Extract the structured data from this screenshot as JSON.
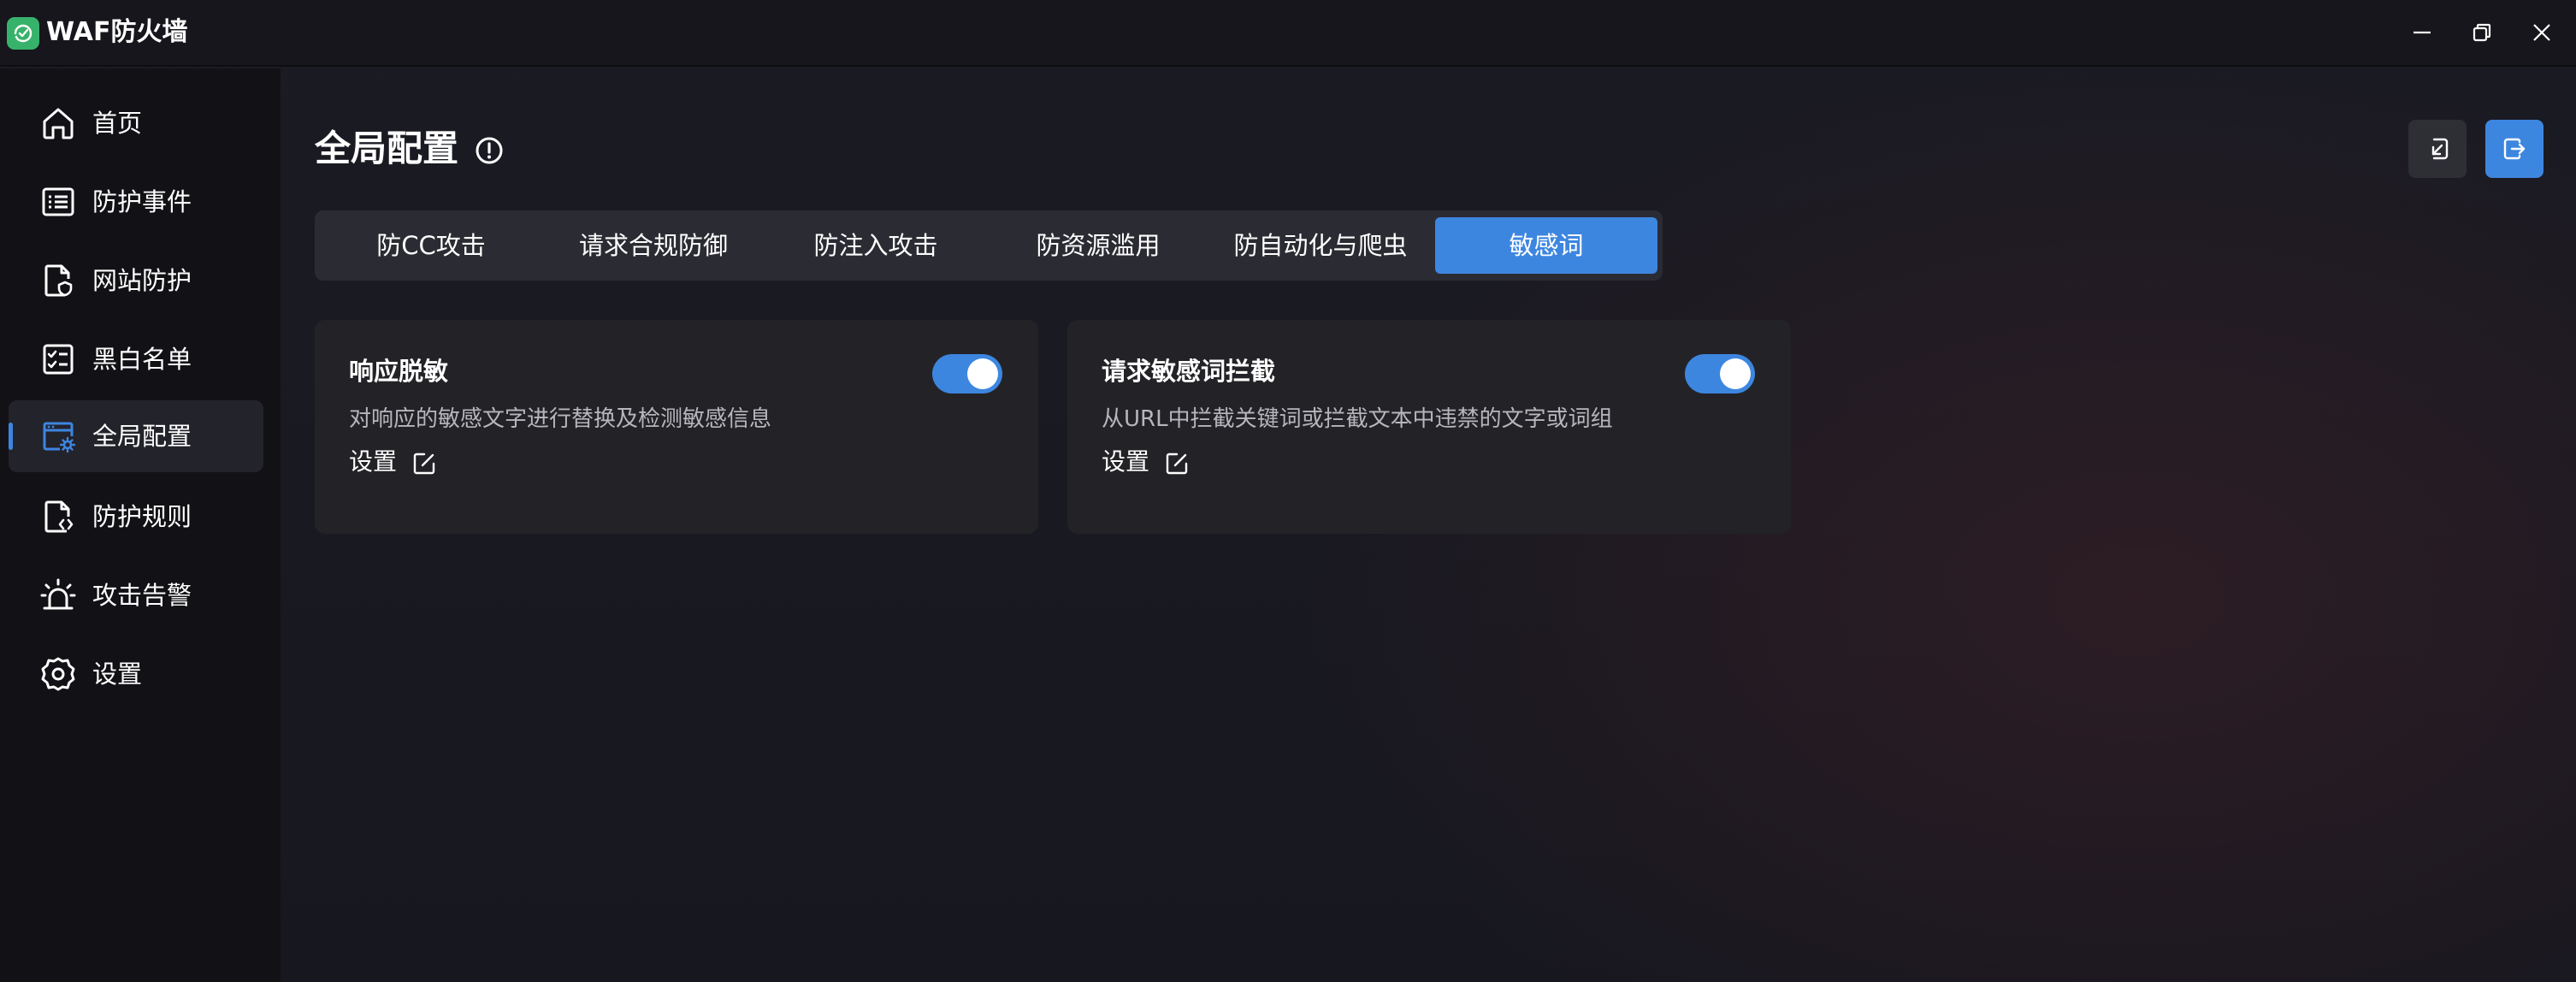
{
  "app": {
    "title": "WAF防火墙"
  },
  "sidebar": {
    "items": [
      {
        "label": "首页",
        "icon": "home-icon",
        "active": false
      },
      {
        "label": "防护事件",
        "icon": "event-list-icon",
        "active": false
      },
      {
        "label": "网站防护",
        "icon": "website-shield-icon",
        "active": false
      },
      {
        "label": "黑白名单",
        "icon": "checklist-icon",
        "active": false
      },
      {
        "label": "全局配置",
        "icon": "global-config-icon",
        "active": true
      },
      {
        "label": "防护规则",
        "icon": "rule-file-icon",
        "active": false
      },
      {
        "label": "攻击告警",
        "icon": "alarm-icon",
        "active": false
      },
      {
        "label": "设置",
        "icon": "gear-icon",
        "active": false
      }
    ]
  },
  "main": {
    "title": "全局配置",
    "tabs": [
      {
        "label": "防CC攻击",
        "active": false
      },
      {
        "label": "请求合规防御",
        "active": false
      },
      {
        "label": "防注入攻击",
        "active": false
      },
      {
        "label": "防资源滥用",
        "active": false
      },
      {
        "label": "防自动化与爬虫",
        "active": false
      },
      {
        "label": "敏感词",
        "active": true
      }
    ],
    "cards": [
      {
        "title": "响应脱敏",
        "description": "对响应的敏感文字进行替换及检测敏感信息",
        "settings_label": "设置",
        "enabled": true
      },
      {
        "title": "请求敏感词拦截",
        "description": "从URL中拦截关键词或拦截文本中违禁的文字或词组",
        "settings_label": "设置",
        "enabled": true
      }
    ]
  },
  "colors": {
    "accent": "#3d86e0",
    "logo": "#37b26a",
    "sidebar_bg": "#121216",
    "card_bg": "#232327"
  }
}
